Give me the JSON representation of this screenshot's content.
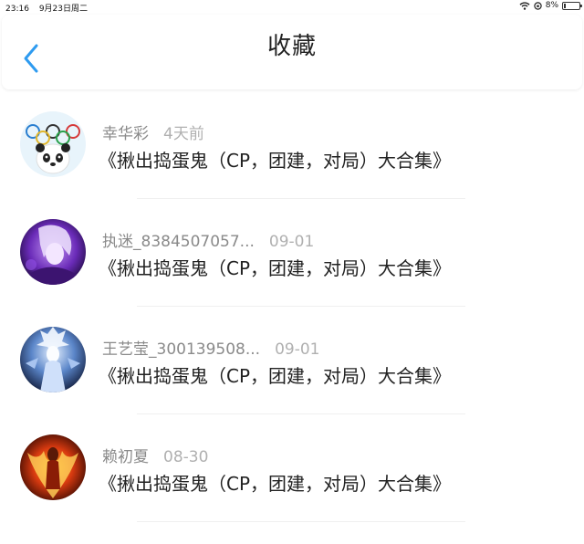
{
  "status_bar": {
    "time": "23:16",
    "date": "9月23日周二",
    "battery": "8%",
    "battery_level": 0.08
  },
  "header": {
    "title": "收藏",
    "back_icon": "chevron-left-icon",
    "accent": "#2e9bf0"
  },
  "items": [
    {
      "name": "幸华彩",
      "time": "4天前",
      "content": "《揪出捣蛋鬼（CP，团建，对局）大合集》",
      "avatar": "olympic-panda"
    },
    {
      "name": "执迷_8384507057...",
      "time": "09-01",
      "content": "《揪出捣蛋鬼（CP，团建，对局）大合集》",
      "avatar": "purple-anime"
    },
    {
      "name": "王艺莹_300139508...",
      "time": "09-01",
      "content": "《揪出捣蛋鬼（CP，团建，对局）大合集》",
      "avatar": "blue-anime"
    },
    {
      "name": "赖初夏",
      "time": "08-30",
      "content": "《揪出捣蛋鬼（CP，团建，对局）大合集》",
      "avatar": "fire-dancer"
    }
  ]
}
